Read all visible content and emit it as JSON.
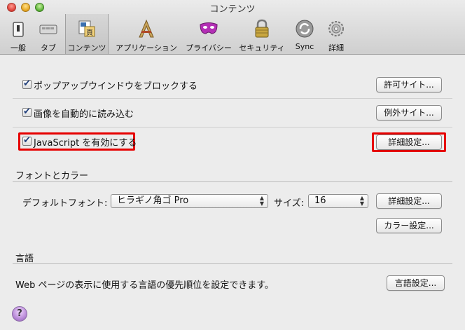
{
  "window": {
    "title": "コンテンツ"
  },
  "toolbar": [
    {
      "label": "一般",
      "icon": "switch-icon"
    },
    {
      "label": "タブ",
      "icon": "tabs-icon"
    },
    {
      "label": "コンテンツ",
      "icon": "content-icon",
      "selected": true
    },
    {
      "label": "アプリケーション",
      "icon": "applications-icon"
    },
    {
      "label": "プライバシー",
      "icon": "mask-icon"
    },
    {
      "label": "セキュリティ",
      "icon": "lock-icon"
    },
    {
      "label": "Sync",
      "icon": "sync-icon"
    },
    {
      "label": "詳細",
      "icon": "gear-icon"
    }
  ],
  "content": {
    "block_popups": {
      "label": "ポップアップウインドウをブロックする",
      "checked": true,
      "button": "許可サイト..."
    },
    "load_images": {
      "label": "画像を自動的に読み込む",
      "checked": true,
      "button": "例外サイト..."
    },
    "javascript": {
      "label": "JavaScript を有効にする",
      "checked": true,
      "button": "詳細設定..."
    }
  },
  "fonts": {
    "section_title": "フォントとカラー",
    "default_font_label": "デフォルトフォント:",
    "default_font_value": "ヒラギノ角ゴ Pro",
    "size_label": "サイズ:",
    "size_value": "16",
    "advanced_button": "詳細設定...",
    "colors_button": "カラー設定..."
  },
  "languages": {
    "section_title": "言語",
    "description": "Web ページの表示に使用する言語の優先順位を設定できます。",
    "button": "言語設定..."
  },
  "help": {
    "label": "?"
  }
}
